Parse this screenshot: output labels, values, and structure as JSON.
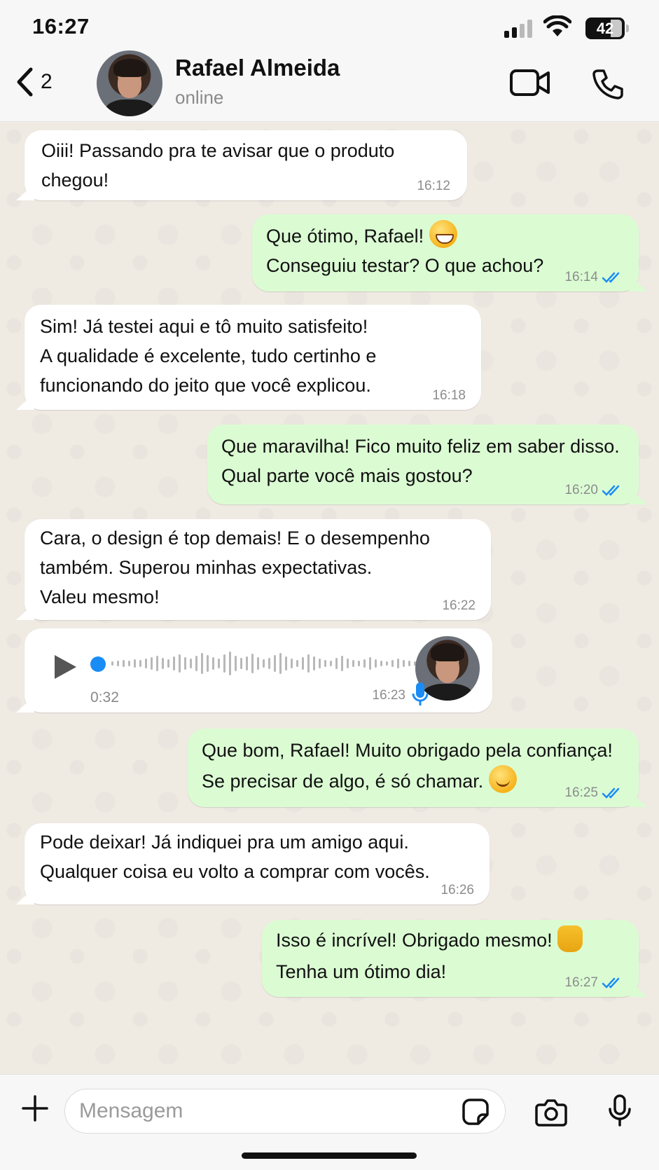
{
  "status_bar": {
    "time": "16:27",
    "battery": "42"
  },
  "header": {
    "back_count": "2",
    "contact_name": "Rafael Almeida",
    "contact_status": "online"
  },
  "messages": [
    {
      "direction": "in",
      "text": "Oiii! Passando pra te avisar que o produto\nchegou!",
      "time": "16:12"
    },
    {
      "direction": "out",
      "text": "Que ótimo, Rafael! ",
      "text2": "Conseguiu testar? O que achou?",
      "emoji": "grinning-face",
      "time": "16:14",
      "read": true
    },
    {
      "direction": "in",
      "text": "Sim! Já testei aqui e tô muito satisfeito!\nA qualidade é excelente, tudo certinho e\nfuncionando do jeito que você explicou.",
      "time": "16:18"
    },
    {
      "direction": "out",
      "text": "Que maravilha! Fico muito feliz em saber disso.\nQual parte você mais gostou?",
      "time": "16:20",
      "read": true
    },
    {
      "direction": "in",
      "text": "Cara, o design é top demais! E o desempenho\ntambém. Superou minhas expectativas.\nValeu mesmo!",
      "time": "16:22"
    },
    {
      "direction": "in",
      "type": "voice",
      "duration": "0:32",
      "time": "16:23"
    },
    {
      "direction": "out",
      "text": "Que bom, Rafael! Muito obrigado pela confiança!",
      "text2": "Se precisar de algo, é só chamar. ",
      "emoji": "smiling-face",
      "time": "16:25",
      "read": true
    },
    {
      "direction": "in",
      "text": "Pode deixar!  Já indiquei pra um amigo aqui.\nQualquer coisa eu volto a comprar com vocês.",
      "time": "16:26"
    },
    {
      "direction": "out",
      "text": "Isso é incrível! Obrigado mesmo! ",
      "text2": "Tenha um ótimo dia!",
      "emoji": "raising-hands",
      "time": "16:27",
      "read": true
    }
  ],
  "composer": {
    "placeholder": "Mensagem"
  },
  "colors": {
    "incoming": "#ffffff",
    "outgoing": "#dbfcd3",
    "read_ticks": "#1a8cf5",
    "background": "#efeae2"
  }
}
